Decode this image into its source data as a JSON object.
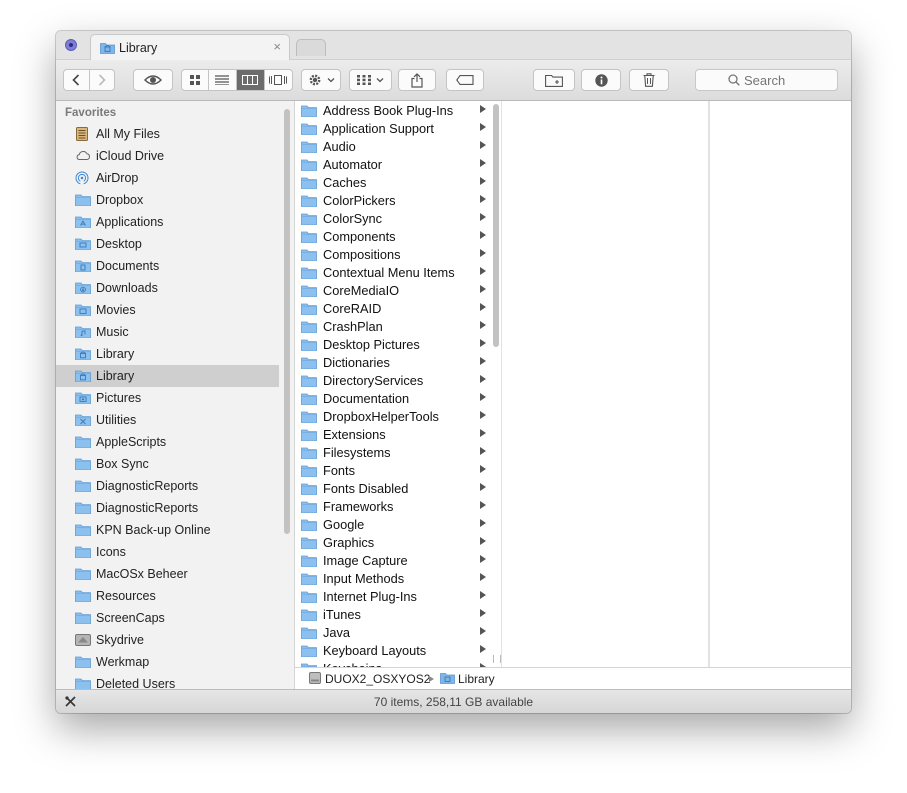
{
  "tab": {
    "title": "Library",
    "close": "×"
  },
  "toolbar": {
    "back_icon": "chevron-left-icon",
    "forward_icon": "chevron-right-icon",
    "quicklook_icon": "eye-icon",
    "view_icons": [
      "icon-view-icon",
      "list-view-icon",
      "column-view-icon",
      "coverflow-view-icon"
    ],
    "active_view": "column-view-icon",
    "action_icon": "gear-icon",
    "arrange_icon": "arrange-grid-icon",
    "share_icon": "share-icon",
    "tag_icon": "tag-icon",
    "newfolder_icon": "new-folder-icon",
    "info_icon": "info-icon",
    "trash_icon": "trash-icon"
  },
  "search": {
    "placeholder": "Search"
  },
  "sidebar": {
    "heading": "Favorites",
    "items": [
      {
        "label": "All My Files",
        "icon": "all-files-icon"
      },
      {
        "label": "iCloud Drive",
        "icon": "cloud-icon"
      },
      {
        "label": "AirDrop",
        "icon": "airdrop-icon"
      },
      {
        "label": "Dropbox",
        "icon": "folder-icon"
      },
      {
        "label": "Applications",
        "icon": "applications-folder-icon"
      },
      {
        "label": "Desktop",
        "icon": "desktop-folder-icon"
      },
      {
        "label": "Documents",
        "icon": "documents-folder-icon"
      },
      {
        "label": "Downloads",
        "icon": "downloads-folder-icon"
      },
      {
        "label": "Movies",
        "icon": "movies-folder-icon"
      },
      {
        "label": "Music",
        "icon": "music-folder-icon"
      },
      {
        "label": "Library",
        "icon": "library-folder-icon"
      },
      {
        "label": "Library",
        "icon": "library-folder-icon",
        "selected": true
      },
      {
        "label": "Pictures",
        "icon": "pictures-folder-icon"
      },
      {
        "label": "Utilities",
        "icon": "utilities-folder-icon"
      },
      {
        "label": "AppleScripts",
        "icon": "folder-icon"
      },
      {
        "label": "Box Sync",
        "icon": "folder-icon"
      },
      {
        "label": "DiagnosticReports",
        "icon": "folder-icon"
      },
      {
        "label": "DiagnosticReports",
        "icon": "folder-icon"
      },
      {
        "label": "KPN Back-up Online",
        "icon": "folder-icon"
      },
      {
        "label": "Icons",
        "icon": "folder-icon"
      },
      {
        "label": "MacOSx Beheer",
        "icon": "folder-icon"
      },
      {
        "label": "Resources",
        "icon": "folder-icon"
      },
      {
        "label": "ScreenCaps",
        "icon": "folder-icon"
      },
      {
        "label": "Skydrive",
        "icon": "drive-icon"
      },
      {
        "label": "Werkmap",
        "icon": "folder-icon"
      },
      {
        "label": "Deleted Users",
        "icon": "folder-icon"
      }
    ]
  },
  "column": {
    "items": [
      "Address Book Plug-Ins",
      "Application Support",
      "Audio",
      "Automator",
      "Caches",
      "ColorPickers",
      "ColorSync",
      "Components",
      "Compositions",
      "Contextual Menu Items",
      "CoreMediaIO",
      "CoreRAID",
      "CrashPlan",
      "Desktop Pictures",
      "Dictionaries",
      "DirectoryServices",
      "Documentation",
      "DropboxHelperTools",
      "Extensions",
      "Filesystems",
      "Fonts",
      "Fonts Disabled",
      "Frameworks",
      "Google",
      "Graphics",
      "Image Capture",
      "Input Methods",
      "Internet Plug-Ins",
      "iTunes",
      "Java",
      "Keyboard Layouts",
      "Keychains"
    ]
  },
  "pathbar": {
    "volume": "DUOX2_OSXYOS2",
    "folder": "Library"
  },
  "status": {
    "text": "70 items, 258,11 GB available"
  }
}
